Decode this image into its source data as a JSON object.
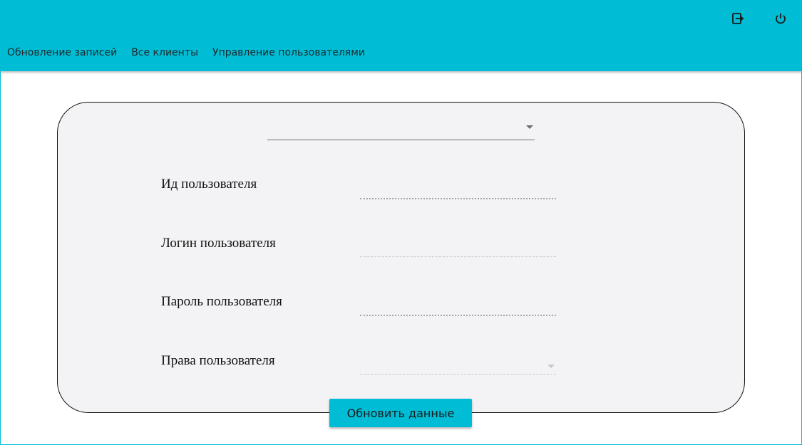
{
  "header": {
    "color": "#00bcd4",
    "icons": {
      "logout": "logout-icon",
      "power": "power-icon"
    },
    "nav": [
      {
        "label": "Обновление записей"
      },
      {
        "label": "Все клиенты"
      },
      {
        "label": "Управление пользователями"
      }
    ]
  },
  "form": {
    "top_select": {
      "value": ""
    },
    "fields": [
      {
        "label": "Ид пользователя",
        "value": ""
      },
      {
        "label": "Логин пользователя",
        "value": ""
      },
      {
        "label": "Пароль пользователя",
        "value": ""
      },
      {
        "label": "Права пользователя",
        "value": ""
      }
    ],
    "submit_label": "Обновить данные"
  }
}
